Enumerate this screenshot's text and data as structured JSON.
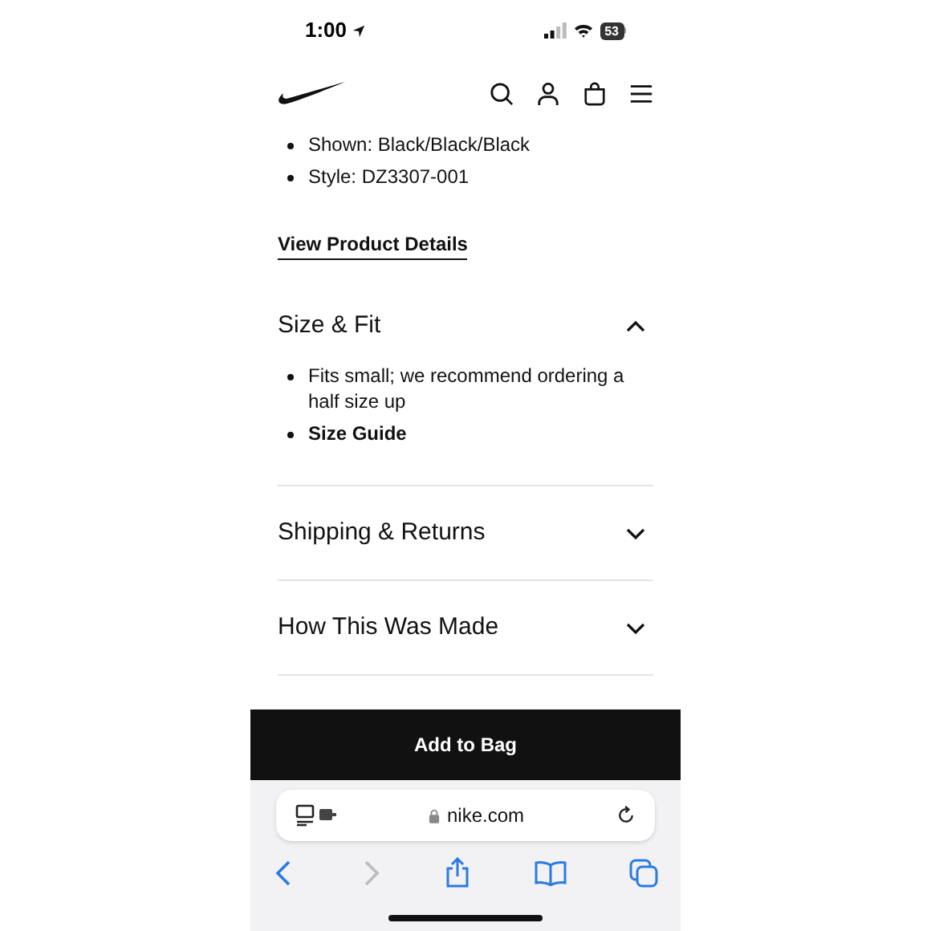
{
  "status_bar": {
    "time": "1:00",
    "battery": "53"
  },
  "details": {
    "bullets": [
      "Shown: Black/Black/Black",
      "Style: DZ3307-001"
    ],
    "link": "View Product Details"
  },
  "sections": [
    {
      "title": "Size & Fit",
      "expanded": true,
      "items": [
        {
          "kind": "text",
          "text": "Fits small; we recommend ordering a half size up"
        },
        {
          "kind": "link",
          "text": "Size Guide"
        }
      ]
    },
    {
      "title": "Shipping & Returns",
      "expanded": false
    },
    {
      "title": "How This Was Made",
      "expanded": false
    }
  ],
  "cta": "Add to Bag",
  "browser": {
    "url": "nike.com"
  }
}
